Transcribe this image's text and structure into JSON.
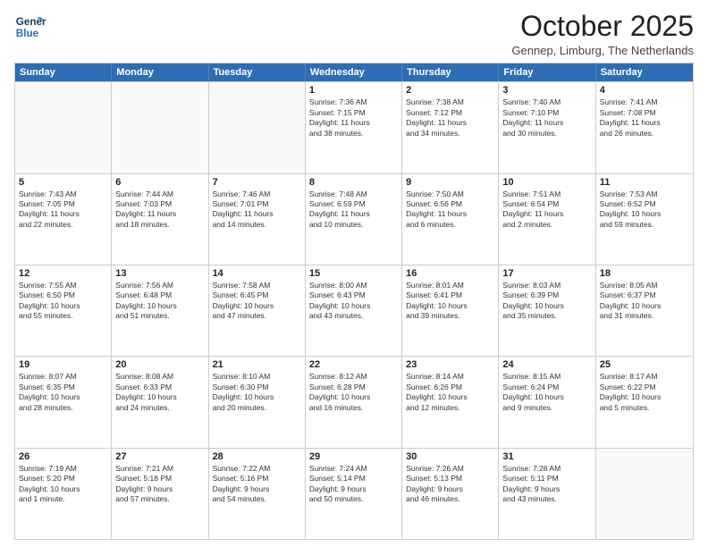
{
  "header": {
    "logo_line1": "General",
    "logo_line2": "Blue",
    "month_title": "October 2025",
    "subtitle": "Gennep, Limburg, The Netherlands"
  },
  "weekdays": [
    "Sunday",
    "Monday",
    "Tuesday",
    "Wednesday",
    "Thursday",
    "Friday",
    "Saturday"
  ],
  "rows": [
    [
      {
        "day": "",
        "info": ""
      },
      {
        "day": "",
        "info": ""
      },
      {
        "day": "",
        "info": ""
      },
      {
        "day": "1",
        "info": "Sunrise: 7:36 AM\nSunset: 7:15 PM\nDaylight: 11 hours\nand 38 minutes."
      },
      {
        "day": "2",
        "info": "Sunrise: 7:38 AM\nSunset: 7:12 PM\nDaylight: 11 hours\nand 34 minutes."
      },
      {
        "day": "3",
        "info": "Sunrise: 7:40 AM\nSunset: 7:10 PM\nDaylight: 11 hours\nand 30 minutes."
      },
      {
        "day": "4",
        "info": "Sunrise: 7:41 AM\nSunset: 7:08 PM\nDaylight: 11 hours\nand 26 minutes."
      }
    ],
    [
      {
        "day": "5",
        "info": "Sunrise: 7:43 AM\nSunset: 7:05 PM\nDaylight: 11 hours\nand 22 minutes."
      },
      {
        "day": "6",
        "info": "Sunrise: 7:44 AM\nSunset: 7:03 PM\nDaylight: 11 hours\nand 18 minutes."
      },
      {
        "day": "7",
        "info": "Sunrise: 7:46 AM\nSunset: 7:01 PM\nDaylight: 11 hours\nand 14 minutes."
      },
      {
        "day": "8",
        "info": "Sunrise: 7:48 AM\nSunset: 6:59 PM\nDaylight: 11 hours\nand 10 minutes."
      },
      {
        "day": "9",
        "info": "Sunrise: 7:50 AM\nSunset: 6:56 PM\nDaylight: 11 hours\nand 6 minutes."
      },
      {
        "day": "10",
        "info": "Sunrise: 7:51 AM\nSunset: 6:54 PM\nDaylight: 11 hours\nand 2 minutes."
      },
      {
        "day": "11",
        "info": "Sunrise: 7:53 AM\nSunset: 6:52 PM\nDaylight: 10 hours\nand 59 minutes."
      }
    ],
    [
      {
        "day": "12",
        "info": "Sunrise: 7:55 AM\nSunset: 6:50 PM\nDaylight: 10 hours\nand 55 minutes."
      },
      {
        "day": "13",
        "info": "Sunrise: 7:56 AM\nSunset: 6:48 PM\nDaylight: 10 hours\nand 51 minutes."
      },
      {
        "day": "14",
        "info": "Sunrise: 7:58 AM\nSunset: 6:45 PM\nDaylight: 10 hours\nand 47 minutes."
      },
      {
        "day": "15",
        "info": "Sunrise: 8:00 AM\nSunset: 6:43 PM\nDaylight: 10 hours\nand 43 minutes."
      },
      {
        "day": "16",
        "info": "Sunrise: 8:01 AM\nSunset: 6:41 PM\nDaylight: 10 hours\nand 39 minutes."
      },
      {
        "day": "17",
        "info": "Sunrise: 8:03 AM\nSunset: 6:39 PM\nDaylight: 10 hours\nand 35 minutes."
      },
      {
        "day": "18",
        "info": "Sunrise: 8:05 AM\nSunset: 6:37 PM\nDaylight: 10 hours\nand 31 minutes."
      }
    ],
    [
      {
        "day": "19",
        "info": "Sunrise: 8:07 AM\nSunset: 6:35 PM\nDaylight: 10 hours\nand 28 minutes."
      },
      {
        "day": "20",
        "info": "Sunrise: 8:08 AM\nSunset: 6:33 PM\nDaylight: 10 hours\nand 24 minutes."
      },
      {
        "day": "21",
        "info": "Sunrise: 8:10 AM\nSunset: 6:30 PM\nDaylight: 10 hours\nand 20 minutes."
      },
      {
        "day": "22",
        "info": "Sunrise: 8:12 AM\nSunset: 6:28 PM\nDaylight: 10 hours\nand 16 minutes."
      },
      {
        "day": "23",
        "info": "Sunrise: 8:14 AM\nSunset: 6:26 PM\nDaylight: 10 hours\nand 12 minutes."
      },
      {
        "day": "24",
        "info": "Sunrise: 8:15 AM\nSunset: 6:24 PM\nDaylight: 10 hours\nand 9 minutes."
      },
      {
        "day": "25",
        "info": "Sunrise: 8:17 AM\nSunset: 6:22 PM\nDaylight: 10 hours\nand 5 minutes."
      }
    ],
    [
      {
        "day": "26",
        "info": "Sunrise: 7:19 AM\nSunset: 5:20 PM\nDaylight: 10 hours\nand 1 minute."
      },
      {
        "day": "27",
        "info": "Sunrise: 7:21 AM\nSunset: 5:18 PM\nDaylight: 9 hours\nand 57 minutes."
      },
      {
        "day": "28",
        "info": "Sunrise: 7:22 AM\nSunset: 5:16 PM\nDaylight: 9 hours\nand 54 minutes."
      },
      {
        "day": "29",
        "info": "Sunrise: 7:24 AM\nSunset: 5:14 PM\nDaylight: 9 hours\nand 50 minutes."
      },
      {
        "day": "30",
        "info": "Sunrise: 7:26 AM\nSunset: 5:13 PM\nDaylight: 9 hours\nand 46 minutes."
      },
      {
        "day": "31",
        "info": "Sunrise: 7:28 AM\nSunset: 5:11 PM\nDaylight: 9 hours\nand 43 minutes."
      },
      {
        "day": "",
        "info": ""
      }
    ]
  ]
}
